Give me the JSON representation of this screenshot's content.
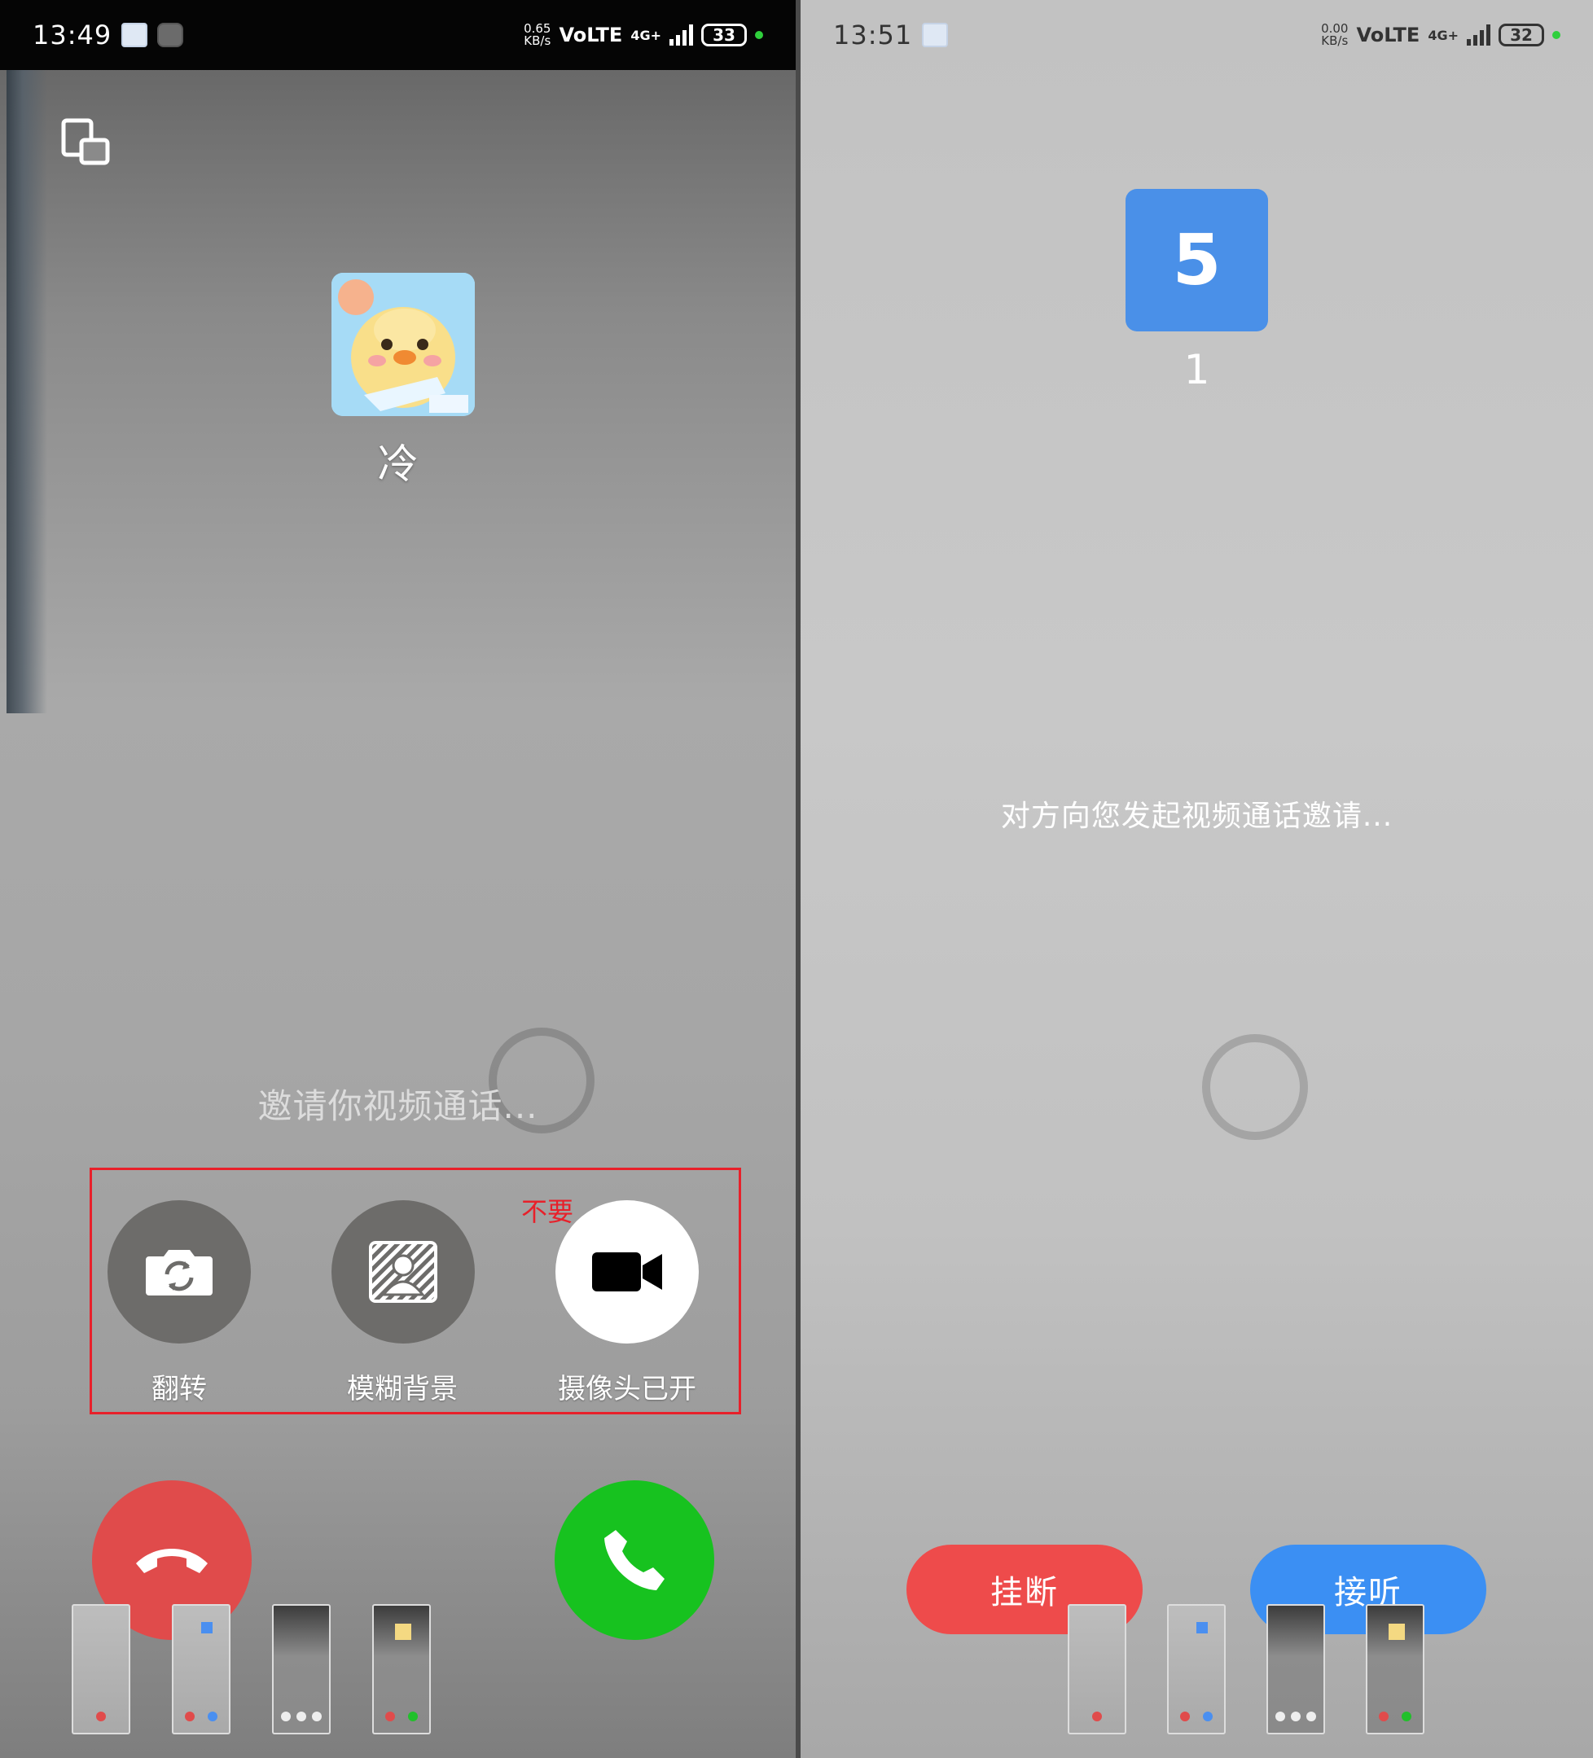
{
  "left_screen": {
    "status_bar": {
      "time": "13:49",
      "speed_value": "0.65",
      "speed_unit": "KB/s",
      "network": "VoLTE",
      "generation": "4G+",
      "battery": "33",
      "app_icons": [
        "notification-app-icon",
        "wechat-icon"
      ]
    },
    "caller": {
      "name": "冷",
      "avatar_icon": "duck-avatar"
    },
    "invite_text": "邀请你视频通话...",
    "annotation": "不要",
    "options": [
      {
        "label": "翻转",
        "icon": "flip-camera-icon"
      },
      {
        "label": "模糊背景",
        "icon": "blur-background-icon"
      },
      {
        "label": "摄像头已开",
        "icon": "video-camera-icon"
      }
    ],
    "hangup_icon": "hangup-phone-icon",
    "answer_icon": "answer-phone-icon",
    "highlight_color": "#e8202a",
    "accent_red": "#e04b4b",
    "accent_green": "#17c21f"
  },
  "right_screen": {
    "status_bar": {
      "time": "13:51",
      "speed_value": "0.00",
      "speed_unit": "KB/s",
      "network": "VoLTE",
      "generation": "4G+",
      "battery": "32"
    },
    "contact": {
      "badge": "5",
      "name": "1"
    },
    "invite_text": "对方向您发起视频通话邀请...",
    "buttons": {
      "hangup": "挂断",
      "answer": "接听"
    },
    "accent_blue": "#3b8ff3",
    "accent_red": "#ee4b4b"
  }
}
